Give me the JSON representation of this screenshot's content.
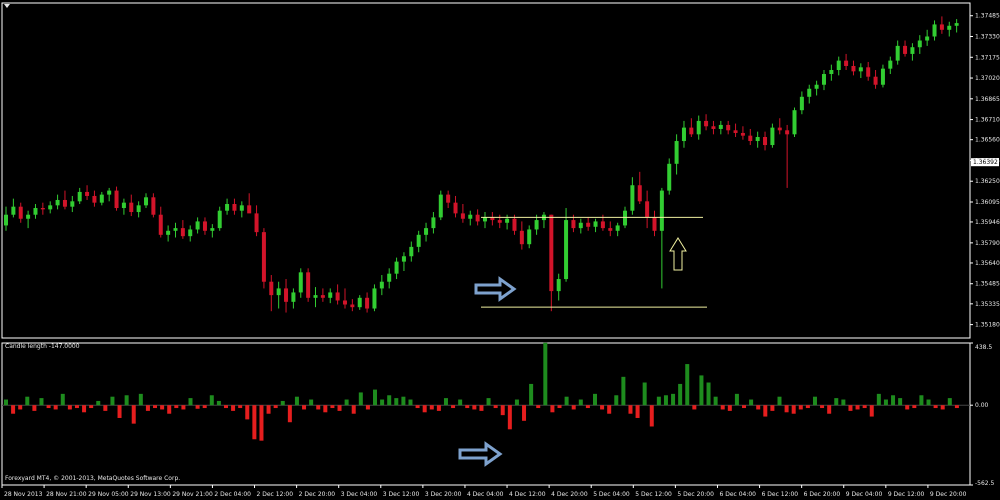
{
  "chart_data": [
    {
      "type": "candlestick",
      "title": "",
      "ylim": [
        1.3508,
        1.3758
      ],
      "y_ticks": [
        "1.37485",
        "1.37330",
        "1.37175",
        "1.37020",
        "1.36865",
        "1.36710",
        "1.36560",
        "1.36405",
        "1.36250",
        "1.36095",
        "1.35946",
        "1.35790",
        "1.35640",
        "1.35485",
        "1.35335",
        "1.35180"
      ],
      "current_price": "1.36392",
      "x_labels": [
        "28 Nov 2013",
        "28 Nov 21:00",
        "29 Nov 05:00",
        "29 Nov 13:00",
        "29 Nov 21:00",
        "2 Dec 04:00",
        "2 Dec 12:00",
        "2 Dec 20:00",
        "3 Dec 04:00",
        "3 Dec 12:00",
        "3 Dec 20:00",
        "4 Dec 04:00",
        "4 Dec 12:00",
        "4 Dec 20:00",
        "5 Dec 04:00",
        "5 Dec 12:00",
        "5 Dec 20:00",
        "6 Dec 04:00",
        "6 Dec 12:00",
        "6 Dec 20:00",
        "9 Dec 04:00",
        "9 Dec 12:00",
        "9 Dec 20:00"
      ],
      "annotations": {
        "upper_line": 1.3598,
        "lower_line": 1.3531,
        "right_arrow": "4 Dec 12:00",
        "up_arrow": "5 Dec 12:00"
      },
      "candles": [
        [
          1.3592,
          1.3606,
          1.3588,
          1.36
        ],
        [
          1.36,
          1.3612,
          1.3598,
          1.3606
        ],
        [
          1.3606,
          1.3609,
          1.3594,
          1.3597
        ],
        [
          1.3597,
          1.3603,
          1.359,
          1.36
        ],
        [
          1.36,
          1.3608,
          1.3597,
          1.3605
        ],
        [
          1.3605,
          1.3609,
          1.36,
          1.3604
        ],
        [
          1.3604,
          1.361,
          1.3601,
          1.3607
        ],
        [
          1.3607,
          1.3615,
          1.3604,
          1.3611
        ],
        [
          1.3611,
          1.3618,
          1.3604,
          1.3606
        ],
        [
          1.3606,
          1.3614,
          1.3602,
          1.361
        ],
        [
          1.361,
          1.362,
          1.3608,
          1.3617
        ],
        [
          1.3617,
          1.3622,
          1.3611,
          1.3614
        ],
        [
          1.3614,
          1.3618,
          1.3606,
          1.3609
        ],
        [
          1.3609,
          1.3617,
          1.3607,
          1.3615
        ],
        [
          1.3615,
          1.362,
          1.361,
          1.3618
        ],
        [
          1.3618,
          1.3621,
          1.3603,
          1.3605
        ],
        [
          1.3605,
          1.3612,
          1.36,
          1.3609
        ],
        [
          1.3609,
          1.3615,
          1.3599,
          1.3602
        ],
        [
          1.3602,
          1.361,
          1.3598,
          1.3607
        ],
        [
          1.3607,
          1.3616,
          1.3605,
          1.3613
        ],
        [
          1.3613,
          1.3616,
          1.3598,
          1.36
        ],
        [
          1.36,
          1.3606,
          1.3583,
          1.3585
        ],
        [
          1.3585,
          1.3592,
          1.358,
          1.3588
        ],
        [
          1.3588,
          1.3594,
          1.3583,
          1.359
        ],
        [
          1.359,
          1.3596,
          1.3582,
          1.3584
        ],
        [
          1.3584,
          1.3592,
          1.358,
          1.3589
        ],
        [
          1.3589,
          1.3598,
          1.3586,
          1.3595
        ],
        [
          1.3595,
          1.3598,
          1.3585,
          1.3588
        ],
        [
          1.3588,
          1.3593,
          1.3583,
          1.359
        ],
        [
          1.359,
          1.3606,
          1.3588,
          1.3603
        ],
        [
          1.3603,
          1.3612,
          1.36,
          1.3608
        ],
        [
          1.3608,
          1.3612,
          1.36,
          1.3603
        ],
        [
          1.3603,
          1.361,
          1.3598,
          1.3607
        ],
        [
          1.3607,
          1.3616,
          1.3603,
          1.3601
        ],
        [
          1.3601,
          1.3607,
          1.3584,
          1.3587
        ],
        [
          1.3587,
          1.359,
          1.3545,
          1.355
        ],
        [
          1.355,
          1.3555,
          1.3528,
          1.354
        ],
        [
          1.354,
          1.355,
          1.353,
          1.3545
        ],
        [
          1.3545,
          1.3552,
          1.3527,
          1.3535
        ],
        [
          1.3535,
          1.3545,
          1.353,
          1.3542
        ],
        [
          1.3542,
          1.356,
          1.3538,
          1.3557
        ],
        [
          1.3557,
          1.356,
          1.3535,
          1.3538
        ],
        [
          1.3538,
          1.3546,
          1.3531,
          1.354
        ],
        [
          1.354,
          1.3545,
          1.3535,
          1.3538
        ],
        [
          1.3538,
          1.3545,
          1.3534,
          1.3542
        ],
        [
          1.3542,
          1.3548,
          1.3533,
          1.3536
        ],
        [
          1.3536,
          1.3545,
          1.353,
          1.3533
        ],
        [
          1.3533,
          1.3537,
          1.3528,
          1.3531
        ],
        [
          1.3531,
          1.354,
          1.3529,
          1.3538
        ],
        [
          1.3538,
          1.3542,
          1.3527,
          1.353
        ],
        [
          1.353,
          1.3548,
          1.3528,
          1.3545
        ],
        [
          1.3545,
          1.3555,
          1.354,
          1.355
        ],
        [
          1.355,
          1.356,
          1.3545,
          1.3556
        ],
        [
          1.3556,
          1.3568,
          1.3552,
          1.3565
        ],
        [
          1.3565,
          1.3572,
          1.3558,
          1.3569
        ],
        [
          1.3569,
          1.358,
          1.3565,
          1.3576
        ],
        [
          1.3576,
          1.3588,
          1.3572,
          1.3585
        ],
        [
          1.3585,
          1.3594,
          1.358,
          1.359
        ],
        [
          1.359,
          1.3602,
          1.3586,
          1.3598
        ],
        [
          1.3598,
          1.3618,
          1.3596,
          1.3615
        ],
        [
          1.3615,
          1.3618,
          1.3605,
          1.3609
        ],
        [
          1.3609,
          1.3614,
          1.3598,
          1.3601
        ],
        [
          1.3601,
          1.3608,
          1.3594,
          1.3597
        ],
        [
          1.3597,
          1.3603,
          1.3592,
          1.36
        ],
        [
          1.36,
          1.3604,
          1.3592,
          1.3595
        ],
        [
          1.3595,
          1.3602,
          1.359,
          1.3598
        ],
        [
          1.3598,
          1.3602,
          1.3592,
          1.3596
        ],
        [
          1.3596,
          1.36,
          1.359,
          1.3594
        ],
        [
          1.3594,
          1.36,
          1.3589,
          1.3597
        ],
        [
          1.3597,
          1.36,
          1.3585,
          1.3588
        ],
        [
          1.3588,
          1.3595,
          1.3574,
          1.3578
        ],
        [
          1.3578,
          1.3592,
          1.3575,
          1.3589
        ],
        [
          1.3589,
          1.36,
          1.3585,
          1.3596
        ],
        [
          1.3596,
          1.3602,
          1.359,
          1.36
        ],
        [
          1.36,
          1.36,
          1.3528,
          1.3543
        ],
        [
          1.3543,
          1.3556,
          1.3536,
          1.3552
        ],
        [
          1.3552,
          1.3605,
          1.355,
          1.3596
        ],
        [
          1.3596,
          1.36,
          1.3587,
          1.359
        ],
        [
          1.359,
          1.3597,
          1.3586,
          1.3594
        ],
        [
          1.3594,
          1.3598,
          1.3588,
          1.3591
        ],
        [
          1.3591,
          1.3597,
          1.3587,
          1.3595
        ],
        [
          1.3595,
          1.36,
          1.3588,
          1.359
        ],
        [
          1.359,
          1.3595,
          1.3584,
          1.3588
        ],
        [
          1.3588,
          1.3594,
          1.3584,
          1.3592
        ],
        [
          1.3592,
          1.3606,
          1.359,
          1.3603
        ],
        [
          1.3603,
          1.3628,
          1.36,
          1.3622
        ],
        [
          1.3622,
          1.3632,
          1.3608,
          1.361
        ],
        [
          1.361,
          1.3618,
          1.359,
          1.3598
        ],
        [
          1.3598,
          1.3603,
          1.3584,
          1.3588
        ],
        [
          1.3588,
          1.362,
          1.3545,
          1.3618
        ],
        [
          1.3618,
          1.3642,
          1.3615,
          1.3638
        ],
        [
          1.3638,
          1.366,
          1.363,
          1.3655
        ],
        [
          1.3655,
          1.367,
          1.365,
          1.3665
        ],
        [
          1.3665,
          1.3672,
          1.3658,
          1.366
        ],
        [
          1.366,
          1.3674,
          1.3656,
          1.367
        ],
        [
          1.367,
          1.3675,
          1.3663,
          1.3666
        ],
        [
          1.3666,
          1.367,
          1.366,
          1.3664
        ],
        [
          1.3664,
          1.367,
          1.366,
          1.3667
        ],
        [
          1.3667,
          1.367,
          1.366,
          1.3663
        ],
        [
          1.3663,
          1.3668,
          1.3658,
          1.3661
        ],
        [
          1.3661,
          1.3666,
          1.3656,
          1.3659
        ],
        [
          1.3659,
          1.3664,
          1.3652,
          1.3655
        ],
        [
          1.3655,
          1.3662,
          1.365,
          1.3658
        ],
        [
          1.3658,
          1.3662,
          1.3648,
          1.3652
        ],
        [
          1.3652,
          1.3668,
          1.365,
          1.3665
        ],
        [
          1.3665,
          1.3672,
          1.366,
          1.3663
        ],
        [
          1.3663,
          1.3667,
          1.362,
          1.366
        ],
        [
          1.366,
          1.368,
          1.3658,
          1.3678
        ],
        [
          1.3678,
          1.3692,
          1.3675,
          1.3688
        ],
        [
          1.3688,
          1.3697,
          1.3683,
          1.3694
        ],
        [
          1.3694,
          1.37,
          1.3689,
          1.3697
        ],
        [
          1.3697,
          1.3708,
          1.3693,
          1.3705
        ],
        [
          1.3705,
          1.3712,
          1.37,
          1.3708
        ],
        [
          1.3708,
          1.3718,
          1.3704,
          1.3715
        ],
        [
          1.3715,
          1.372,
          1.3708,
          1.3711
        ],
        [
          1.3711,
          1.3715,
          1.3704,
          1.3707
        ],
        [
          1.3707,
          1.3713,
          1.3702,
          1.371
        ],
        [
          1.371,
          1.3714,
          1.37,
          1.3703
        ],
        [
          1.3703,
          1.3708,
          1.3694,
          1.3697
        ],
        [
          1.3697,
          1.3712,
          1.3695,
          1.3709
        ],
        [
          1.3709,
          1.3718,
          1.3705,
          1.3715
        ],
        [
          1.3715,
          1.373,
          1.3712,
          1.3726
        ],
        [
          1.3726,
          1.373,
          1.3718,
          1.372
        ],
        [
          1.372,
          1.3728,
          1.3715,
          1.3725
        ],
        [
          1.3725,
          1.3734,
          1.372,
          1.373
        ],
        [
          1.373,
          1.3738,
          1.3726,
          1.3733
        ],
        [
          1.3733,
          1.3745,
          1.373,
          1.3742
        ],
        [
          1.3742,
          1.3748,
          1.3735,
          1.3738
        ],
        [
          1.3738,
          1.3744,
          1.3733,
          1.3741
        ],
        [
          1.3741,
          1.3746,
          1.3736,
          1.3743
        ]
      ]
    },
    {
      "type": "bar",
      "title": "Candle length -147.0000",
      "ylim": [
        -562.5,
        438.5
      ],
      "y_ticks": [
        "438.5",
        "0.00",
        "-562.5"
      ],
      "footer": "Forexyard MT4, © 2001-2013, MetaQuotes Software Corp.",
      "values": [
        40,
        -60,
        -30,
        60,
        -40,
        50,
        -20,
        -30,
        80,
        -30,
        -20,
        -50,
        -20,
        30,
        -40,
        60,
        -90,
        70,
        -130,
        80,
        -40,
        -20,
        -30,
        -60,
        -20,
        -30,
        50,
        -25,
        -20,
        70,
        30,
        -20,
        -40,
        -20,
        -100,
        -240,
        -250,
        -60,
        -20,
        30,
        -120,
        60,
        -30,
        40,
        -30,
        -50,
        -20,
        -40,
        40,
        -60,
        90,
        -30,
        110,
        40,
        70,
        50,
        60,
        40,
        -20,
        -50,
        -30,
        -40,
        50,
        -20,
        40,
        -20,
        -30,
        -40,
        50,
        -20,
        -70,
        -170,
        40,
        -110,
        150,
        -20,
        440,
        -50,
        -20,
        60,
        -30,
        40,
        -20,
        80,
        -30,
        -60,
        70,
        200,
        -60,
        -90,
        160,
        -150,
        60,
        70,
        80,
        150,
        290,
        -30,
        210,
        160,
        60,
        -30,
        -40,
        80,
        -20,
        40,
        -30,
        -80,
        -40,
        60,
        -50,
        -60,
        -30,
        -20,
        60,
        -20,
        -60,
        50,
        40,
        -40,
        -30,
        -20,
        -80,
        80,
        40,
        70,
        50,
        -30,
        -20,
        70,
        40,
        -20,
        -30,
        50,
        -20
      ]
    }
  ]
}
